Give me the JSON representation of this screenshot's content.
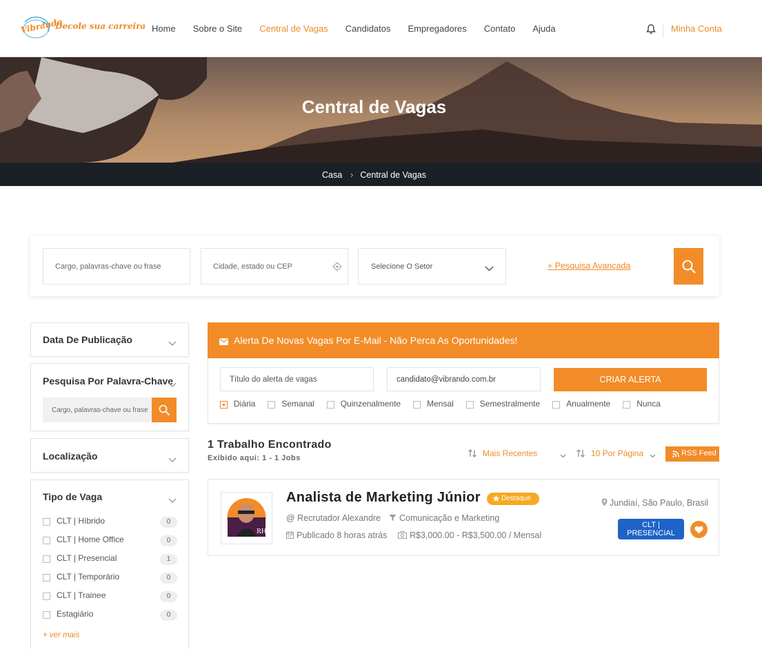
{
  "header": {
    "logo_brand": "Vibrando",
    "logo_tagline": "Decole sua carreira",
    "nav": [
      "Home",
      "Sobre o Site",
      "Central de Vagas",
      "Candidatos",
      "Empregadores",
      "Contato",
      "Ajuda"
    ],
    "active_nav": "Central de Vagas",
    "account_label": "Minha Conta"
  },
  "hero": {
    "title": "Central de Vagas",
    "breadcrumb": [
      "Casa",
      "Central de Vagas"
    ]
  },
  "search": {
    "keywords_placeholder": "Cargo, palavras-chave ou frase",
    "location_placeholder": "Cidade, estado ou CEP",
    "sector_label": "Selecione O Setor",
    "advanced_label": "+ Pesquisa Avançada"
  },
  "sidebar": {
    "date_title": "Data De Publicação",
    "keyword_title": "Pesquisa Por Palavra-Chave",
    "keyword_placeholder": "Cargo, palavras-chave ou frase",
    "location_title": "Localização",
    "type_title": "Tipo de Vaga",
    "types": [
      {
        "label": "CLT | Híbrido",
        "count": "0"
      },
      {
        "label": "CLT | Home Office",
        "count": "0"
      },
      {
        "label": "CLT | Presencial",
        "count": "1"
      },
      {
        "label": "CLT | Temporário",
        "count": "0"
      },
      {
        "label": "CLT | Trainee",
        "count": "0"
      },
      {
        "label": "Estagiário",
        "count": "0"
      }
    ],
    "more_label": "+ ver mais"
  },
  "alert": {
    "title": "Alerta De Novas Vagas Por E-Mail - Não Perca As Oportunidades!",
    "title_placeholder": "Título do alerta de vagas",
    "email_value": "candidato@vibrando.com.br",
    "button_label": "CRIAR ALERTA",
    "frequencies": [
      "Diária",
      "Semanal",
      "Quinzenalmente",
      "Mensal",
      "Semestralmente",
      "Anualmente",
      "Nunca"
    ],
    "selected_frequency": "Diária"
  },
  "results": {
    "count_label": "1 Trabalho Encontrado",
    "shown_label": "Exibido aqui: 1 - 1 Jobs",
    "sort_label": "Mais Recentes",
    "per_page_label": "10 Por Página",
    "rss_label": "RSS Feed"
  },
  "job": {
    "title": "Analista de Marketing Júnior",
    "featured_label": "Destaque",
    "recruiter": "@ Recrutador Alexandre",
    "category": "Comunicação e Marketing",
    "posted": "Publicado 8 horas atrás",
    "salary": "R$3,000.00 - R$3,500.00 / Mensal",
    "location": "Jundiaí, São Paulo, Brasil",
    "type_line1": "CLT |",
    "type_line2": "PRESENCIAL",
    "logo_text": "RH"
  },
  "colors": {
    "accent": "#f28c28",
    "dark_bar": "#1b2026",
    "type_badge": "#1e63c7",
    "featured": "#f6a922"
  }
}
